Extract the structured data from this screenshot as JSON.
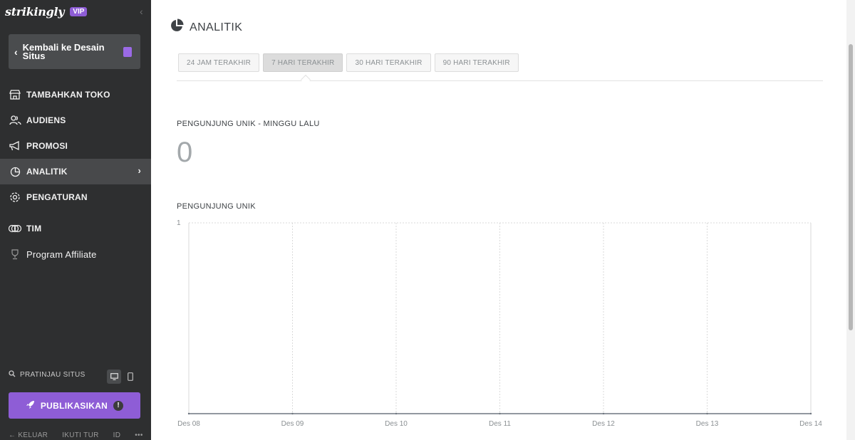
{
  "brand": {
    "name": "strikingly",
    "badge": "VIP"
  },
  "sidebar": {
    "back_label": "Kembali ke Desain Situs",
    "items": [
      {
        "label": "TAMBAHKAN TOKO",
        "icon": "store-icon"
      },
      {
        "label": "AUDIENS",
        "icon": "users-icon"
      },
      {
        "label": "PROMOSI",
        "icon": "megaphone-icon"
      },
      {
        "label": "ANALITIK",
        "icon": "pie-chart-icon",
        "active": true
      },
      {
        "label": "PENGATURAN",
        "icon": "gear-icon"
      },
      {
        "label": "TIM",
        "icon": "team-icon"
      },
      {
        "label": "Program Affiliate",
        "icon": "trophy-icon"
      }
    ],
    "preview_label": "PRATINJAU SITUS",
    "publish_label": "PUBLIKASIKAN",
    "footer": [
      "← KELUAR",
      "IKUTI TUR",
      "ID",
      "•••"
    ]
  },
  "main": {
    "title": "ANALITIK",
    "range_tabs": [
      "24 JAM TERAKHIR",
      "7 HARI TERAKHIR",
      "30 HARI TERAKHIR",
      "90 HARI TERAKHIR"
    ],
    "active_tab": 1,
    "kpi_label": "PENGUNJUNG UNIK - MINGGU LALU",
    "kpi_value": "0",
    "chart_label": "PENGUNJUNG UNIK"
  },
  "chart_data": {
    "type": "line",
    "title": "",
    "categories": [
      "Des 08",
      "Des 09",
      "Des 10",
      "Des 11",
      "Des 12",
      "Des 13",
      "Des 14"
    ],
    "series": [
      {
        "values": [
          0,
          0,
          0,
          0,
          0,
          0,
          0
        ]
      }
    ],
    "y_tick_labels": [
      "1"
    ],
    "ylim": [
      0,
      1
    ],
    "grid": true,
    "legend": "none"
  },
  "colors": {
    "sidebar_bg": "#2e2f30",
    "accent": "#8e5dd6",
    "active_item": "#48494b"
  }
}
